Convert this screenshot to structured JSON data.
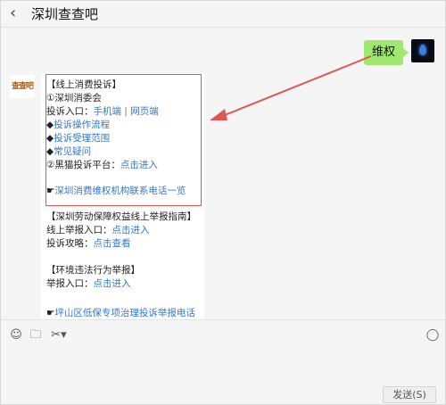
{
  "header": {
    "title": "深圳查查吧",
    "back_icon": "chevron-left-icon"
  },
  "user_message": "维权",
  "bot_avatar_text": "查查吧",
  "bot_message": {
    "box_lines": [
      {
        "text": "【线上消费投诉】"
      },
      {
        "text": "①深圳消委会"
      },
      {
        "prefix": "投诉入口：",
        "link1": "手机端",
        "sep": " | ",
        "link2": "网页端"
      },
      {
        "bullet": "◆",
        "link": "投诉操作流程"
      },
      {
        "bullet": "◆",
        "link": "投诉受理范围"
      },
      {
        "bullet": "◆",
        "link": "常见疑问"
      },
      {
        "prefix": "②黑猫投诉平台：",
        "link": "点击进入"
      },
      {
        "bullet": "☛",
        "link": "深圳消费维权机构联系电话一览"
      }
    ],
    "labor": {
      "heading": "【深圳劳动保障权益线上举报指南】",
      "line1_prefix": "线上举报入口：",
      "line1_link": "点击进入",
      "line2_prefix": "投诉攻略：",
      "line2_link": "点击查看"
    },
    "env": {
      "heading": "【环境违法行为举报】",
      "line_prefix": "举报入口：",
      "line_link": "点击进入"
    },
    "last_line": {
      "bullet": "☛",
      "link": "坪山区低保专项治理投诉举报电话"
    }
  },
  "toolbar": {
    "emoji_icon": "smiley-icon",
    "folder_icon": "folder-icon",
    "scissors_icon": "scissors-icon",
    "mic_icon": "microphone-icon"
  },
  "send_label": "发送(S)",
  "colors": {
    "link": "#3278c8",
    "user_bubble": "#9fe870",
    "highlight": "#e05555",
    "background": "#f5f5f5"
  }
}
